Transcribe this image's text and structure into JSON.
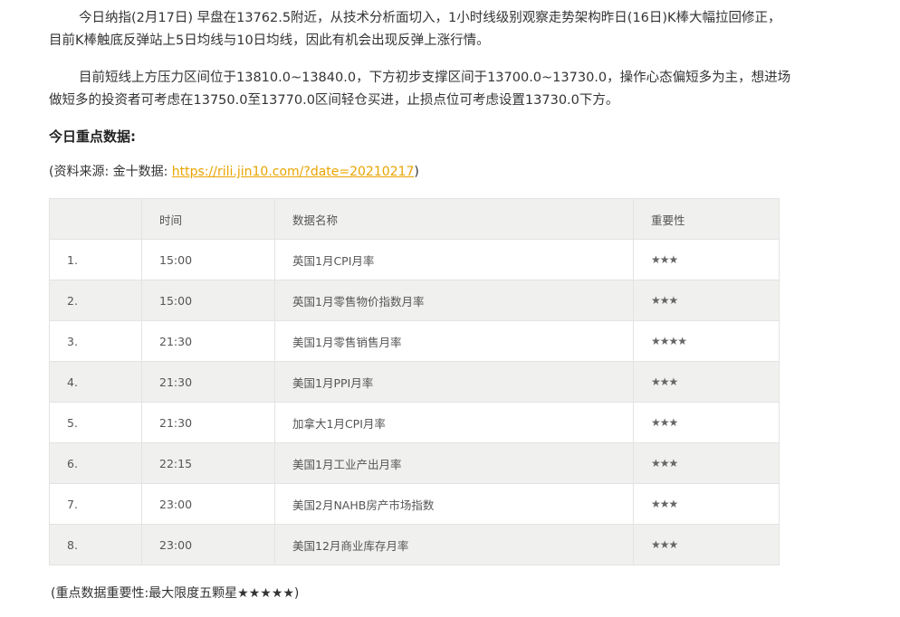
{
  "article": {
    "paragraph1": "今日纳指(2月17日) 早盘在13762.5附近，从技术分析面切入，1小时线级别观察走势架构昨日(16日)K棒大幅拉回修正，目前K棒触底反弹站上5日均线与10日均线，因此有机会出现反弹上涨行情。",
    "paragraph2": "目前短线上方压力区间位于13810.0~13840.0，下方初步支撑区间于13700.0~13730.0，操作心态偏短多为主，想进场做短多的投资者可考虑在13750.0至13770.0区间轻仓买进，止损点位可考虑设置13730.0下方。",
    "heading": "今日重点数据:",
    "source_prefix": "(资料来源: 金十数据: ",
    "source_link": "https://rili.jin10.com/?date=20210217",
    "source_suffix": ")",
    "note": "(重点数据重要性:最大限度五颗星★★★★★)"
  },
  "table": {
    "headers": [
      "",
      "时间",
      "数据名称",
      "重要性"
    ],
    "rows": [
      [
        "1.",
        "15:00",
        "英国1月CPI月率",
        "★★★"
      ],
      [
        "2.",
        "15:00",
        "英国1月零售物价指数月率",
        "★★★"
      ],
      [
        "3.",
        "21:30",
        "美国1月零售销售月率",
        "★★★★"
      ],
      [
        "4.",
        "21:30",
        "美国1月PPI月率",
        "★★★"
      ],
      [
        "5.",
        "21:30",
        "加拿大1月CPI月率",
        "★★★"
      ],
      [
        "6.",
        "22:15",
        "美国1月工业产出月率",
        "★★★"
      ],
      [
        "7.",
        "23:00",
        "美国2月NAHB房产市场指数",
        "★★★"
      ],
      [
        "8.",
        "23:00",
        "美国12月商业库存月率",
        "★★★"
      ]
    ]
  },
  "colors": {
    "link": "#e9a400",
    "table_stripe": "#f0f0ee",
    "table_border": "#e3e3e3"
  }
}
